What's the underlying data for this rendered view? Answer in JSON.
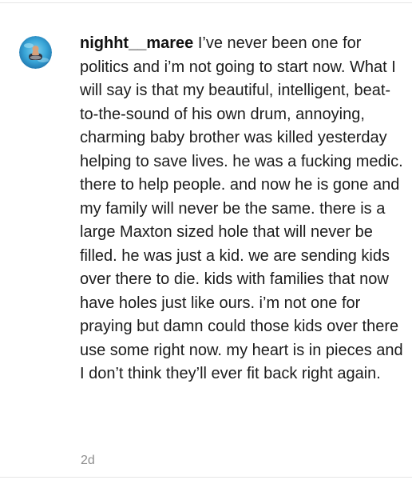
{
  "comment": {
    "username": "nighht__maree",
    "text": "I’ve never been one for politics and i’m not going to start now. What I will say is that my beautiful, intelligent, beat-to-the-sound of his own drum, annoying, charming baby brother was killed yesterday helping to save lives. he was a fucking medic. there to help people. and now he is gone and my family will never be the same. there is a large Maxton sized hole that will never be filled. he was just a kid. we are sending kids over there to die. kids with families that now have holes just like ours. i’m not one for praying but damn could those kids over there use some right now. my heart is in pieces and I don’t think they’ll ever fit back right again.",
    "timestamp": "2d",
    "avatar_icon": "profile-avatar-pool-photo"
  },
  "colors": {
    "text": "#1c1c1c",
    "timestamp": "#8e8e8e",
    "divider": "#e6e6e6",
    "avatar_water": "#3aa6d8"
  }
}
